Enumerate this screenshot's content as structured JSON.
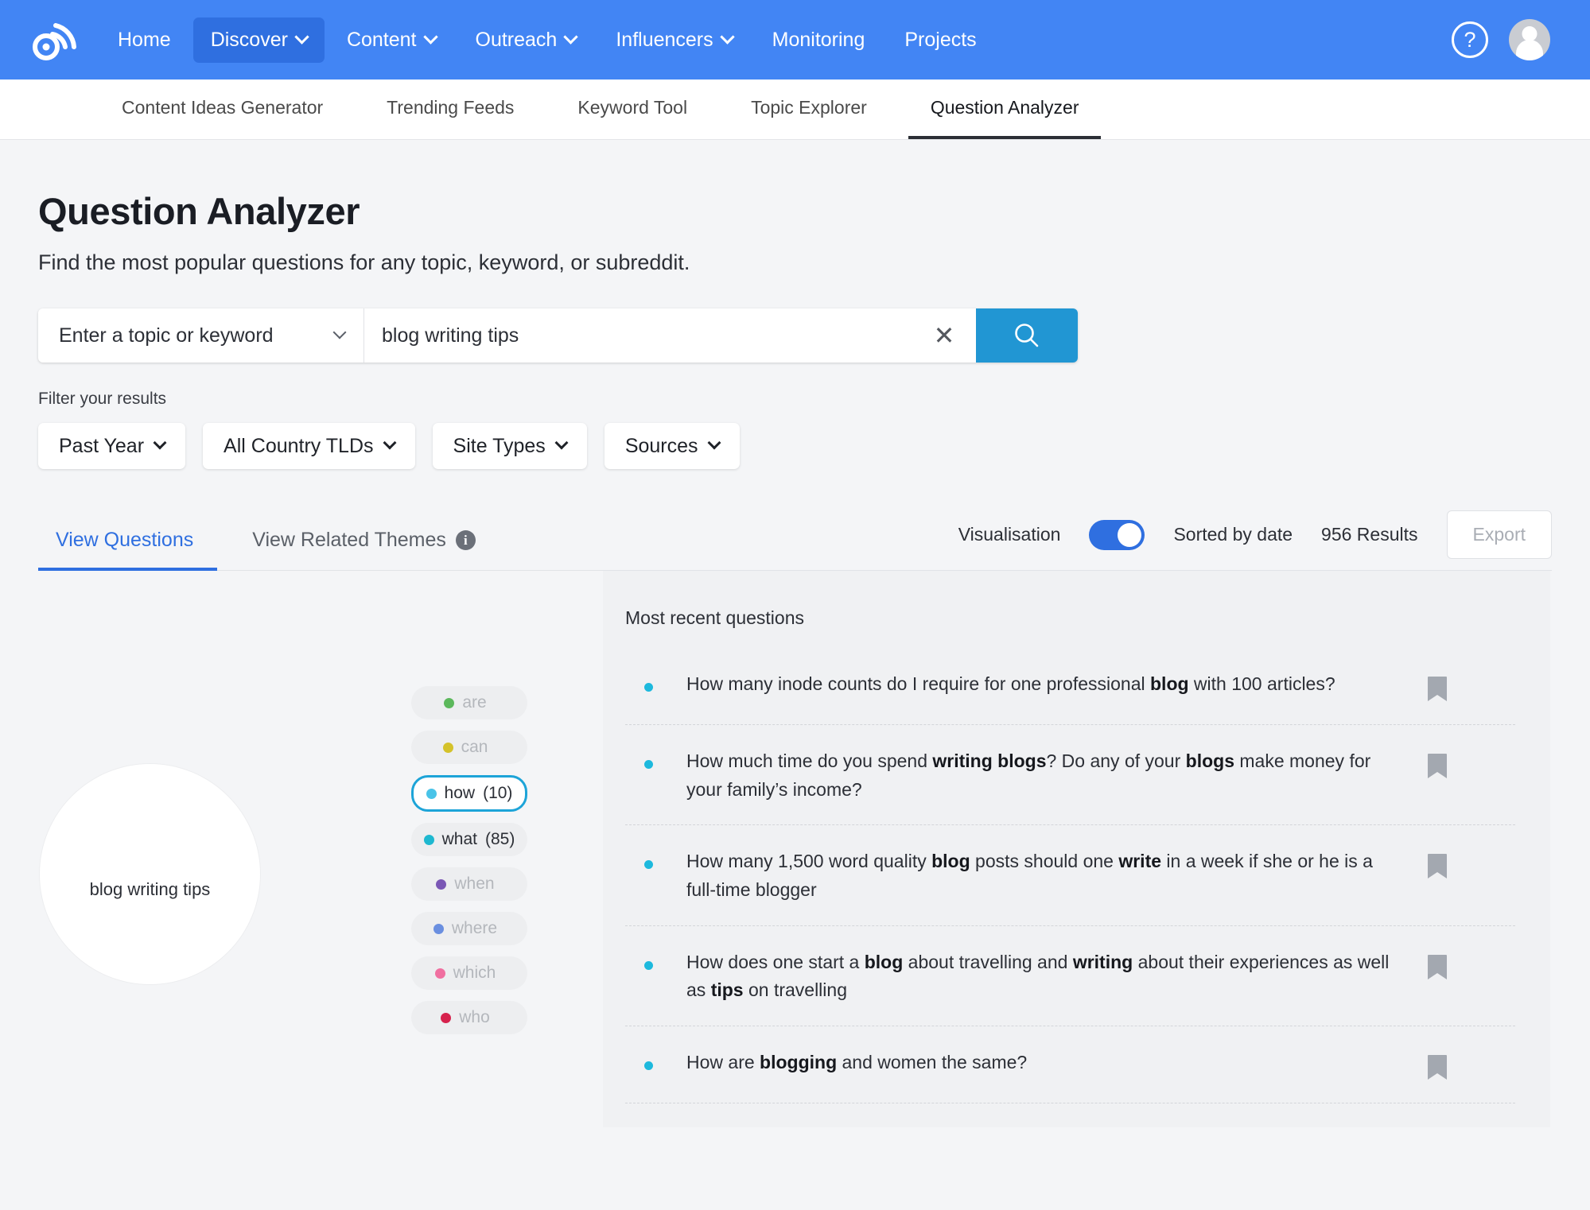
{
  "brand": {
    "logo_name": "buzzsumo-logo",
    "color": "#4285f4"
  },
  "topnav": {
    "items": [
      {
        "label": "Home",
        "has_caret": false,
        "active": false
      },
      {
        "label": "Discover",
        "has_caret": true,
        "active": true
      },
      {
        "label": "Content",
        "has_caret": true,
        "active": false
      },
      {
        "label": "Outreach",
        "has_caret": true,
        "active": false
      },
      {
        "label": "Influencers",
        "has_caret": true,
        "active": false
      },
      {
        "label": "Monitoring",
        "has_caret": false,
        "active": false
      },
      {
        "label": "Projects",
        "has_caret": false,
        "active": false
      }
    ],
    "help_glyph": "?"
  },
  "subnav": {
    "items": [
      {
        "label": "Content Ideas Generator",
        "active": false
      },
      {
        "label": "Trending Feeds",
        "active": false
      },
      {
        "label": "Keyword Tool",
        "active": false
      },
      {
        "label": "Topic Explorer",
        "active": false
      },
      {
        "label": "Question Analyzer",
        "active": true
      }
    ]
  },
  "page": {
    "title": "Question Analyzer",
    "subtitle": "Find the most popular questions for any topic, keyword, or subreddit."
  },
  "search": {
    "select_label": "Enter a topic or keyword",
    "value": "blog writing tips",
    "placeholder": "Enter a topic or keyword",
    "clear_glyph": "✕"
  },
  "filters": {
    "label": "Filter your results",
    "items": [
      {
        "label": "Past Year"
      },
      {
        "label": "All Country TLDs"
      },
      {
        "label": "Site Types"
      },
      {
        "label": "Sources"
      }
    ]
  },
  "tabs": {
    "items": [
      {
        "label": "View Questions",
        "active": true
      },
      {
        "label": "View Related Themes",
        "active": false
      }
    ],
    "visualisation_label": "Visualisation",
    "visualisation_on": true,
    "sorted_by": "Sorted by date",
    "results": "956 Results",
    "export_label": "Export"
  },
  "visualisation": {
    "bubble_label": "blog writing tips",
    "pills": [
      {
        "label": "are",
        "count": "",
        "color": "#5cb85c",
        "selected": false
      },
      {
        "label": "can",
        "count": "",
        "color": "#d4c22a",
        "selected": false
      },
      {
        "label": "how",
        "count": "(10)",
        "color": "#49c3e8",
        "selected": true
      },
      {
        "label": "what",
        "count": "(85)",
        "color": "#1eb8d0",
        "selected": false
      },
      {
        "label": "when",
        "count": "",
        "color": "#7a57b5",
        "selected": false
      },
      {
        "label": "where",
        "count": "",
        "color": "#6a8fe0",
        "selected": false
      },
      {
        "label": "which",
        "count": "",
        "color": "#f06fa0",
        "selected": false
      },
      {
        "label": "who",
        "count": "",
        "color": "#d6224d",
        "selected": false
      }
    ]
  },
  "questions_panel": {
    "title": "Most recent questions",
    "items": [
      {
        "parts": [
          {
            "t": "How many inode counts do I require for one professional ",
            "b": false
          },
          {
            "t": "blog",
            "b": true
          },
          {
            "t": " with 100 articles?",
            "b": false
          }
        ]
      },
      {
        "parts": [
          {
            "t": "How much time do you spend ",
            "b": false
          },
          {
            "t": "writing blogs",
            "b": true
          },
          {
            "t": "? Do any of your ",
            "b": false
          },
          {
            "t": "blogs",
            "b": true
          },
          {
            "t": " make money for your family’s income?",
            "b": false
          }
        ]
      },
      {
        "parts": [
          {
            "t": "How many 1,500 word quality ",
            "b": false
          },
          {
            "t": "blog",
            "b": true
          },
          {
            "t": " posts should one ",
            "b": false
          },
          {
            "t": "write",
            "b": true
          },
          {
            "t": " in a week if she or he is a full-time blogger",
            "b": false
          }
        ]
      },
      {
        "parts": [
          {
            "t": "How does one start a ",
            "b": false
          },
          {
            "t": "blog",
            "b": true
          },
          {
            "t": " about travelling and ",
            "b": false
          },
          {
            "t": "writing",
            "b": true
          },
          {
            "t": " about their experiences as well as ",
            "b": false
          },
          {
            "t": "tips",
            "b": true
          },
          {
            "t": " on travelling",
            "b": false
          }
        ]
      },
      {
        "parts": [
          {
            "t": "How are ",
            "b": false
          },
          {
            "t": "blogging",
            "b": true
          },
          {
            "t": " and women the same?",
            "b": false
          }
        ]
      }
    ]
  }
}
